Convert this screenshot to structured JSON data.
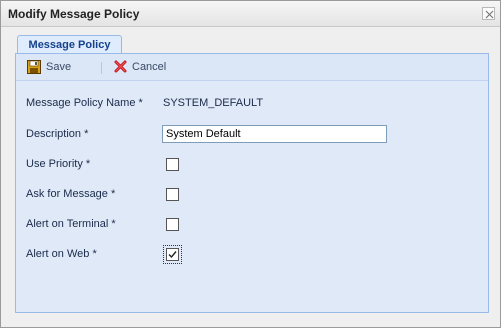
{
  "window": {
    "title": "Modify Message Policy"
  },
  "tab": {
    "label": "Message Policy"
  },
  "toolbar": {
    "save_label": "Save",
    "cancel_label": "Cancel"
  },
  "form": {
    "policy_name_label": "Message Policy Name *",
    "policy_name_value": "SYSTEM_DEFAULT",
    "description_label": "Description *",
    "description_value": "System Default",
    "use_priority_label": "Use Priority *",
    "use_priority_checked": false,
    "ask_for_message_label": "Ask for Message *",
    "ask_for_message_checked": false,
    "alert_on_terminal_label": "Alert on Terminal *",
    "alert_on_terminal_checked": false,
    "alert_on_web_label": "Alert on Web *",
    "alert_on_web_checked": true
  },
  "icons": {
    "save": "floppy-disk-icon",
    "cancel": "red-x-icon",
    "close": "close-icon"
  },
  "colors": {
    "panel_bg": "#dfe9f7",
    "panel_border": "#99bbe8",
    "tab_text": "#15428b"
  }
}
